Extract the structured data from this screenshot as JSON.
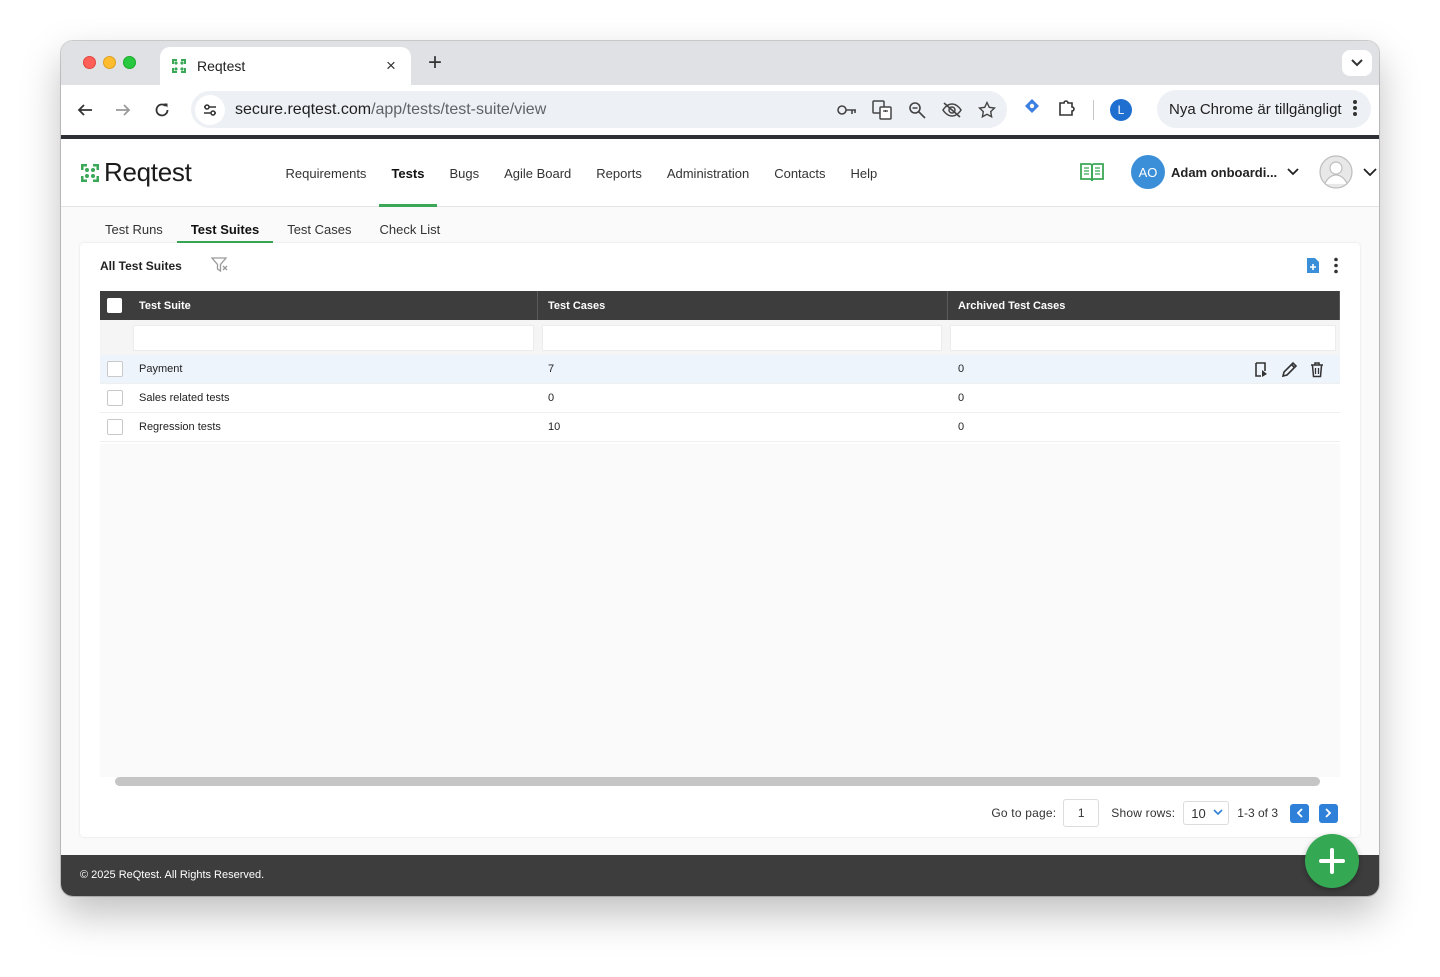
{
  "browser": {
    "tab_title": "Reqtest",
    "tab_close": "×",
    "new_tab": "+",
    "url_host": "secure.reqtest.com",
    "url_path": "/app/tests/test-suite/view",
    "profile_initial": "L",
    "update_label": "Nya Chrome är tillgängligt"
  },
  "app": {
    "logo_text": "Reqtest",
    "brand_color": "#3aa856",
    "nav": [
      {
        "label": "Requirements"
      },
      {
        "label": "Tests"
      },
      {
        "label": "Bugs"
      },
      {
        "label": "Agile Board"
      },
      {
        "label": "Reports"
      },
      {
        "label": "Administration"
      },
      {
        "label": "Contacts"
      },
      {
        "label": "Help"
      }
    ],
    "active_nav": "Tests",
    "user_initials": "AO",
    "user_name": "Adam onboardi..."
  },
  "subtabs": [
    {
      "label": "Test Runs"
    },
    {
      "label": "Test Suites"
    },
    {
      "label": "Test Cases"
    },
    {
      "label": "Check List"
    }
  ],
  "active_subtab": "Test Suites",
  "card": {
    "title": "All Test Suites"
  },
  "grid": {
    "columns": {
      "suite": "Test Suite",
      "cases": "Test Cases",
      "archived": "Archived Test Cases"
    },
    "rows": [
      {
        "suite": "Payment",
        "cases": "7",
        "archived": "0"
      },
      {
        "suite": "Sales related tests",
        "cases": "0",
        "archived": "0"
      },
      {
        "suite": "Regression tests",
        "cases": "10",
        "archived": "0"
      }
    ]
  },
  "pager": {
    "goto_label": "Go to page:",
    "page": "1",
    "rows_label": "Show rows:",
    "rows_value": "10",
    "range": "1-3 of 3"
  },
  "footer": {
    "copyright": "© 2025 ReQtest. All Rights Reserved."
  }
}
